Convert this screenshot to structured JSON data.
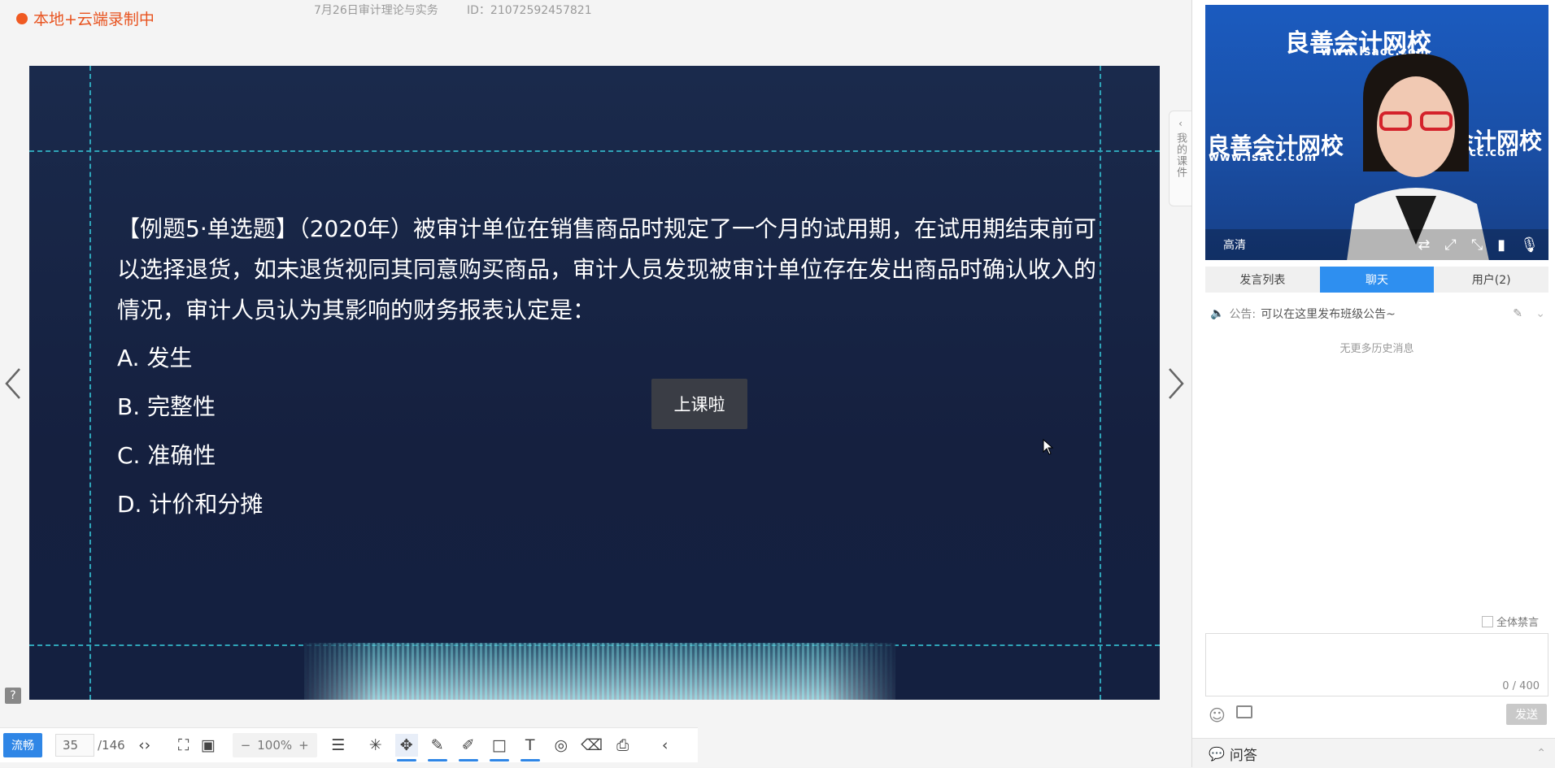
{
  "header": {
    "recording_status": "本地+云端录制中",
    "course_title": "7月26日审计理论与实务",
    "course_id": "ID：21072592457821"
  },
  "slide": {
    "question": "【例题5·单选题】（2020年）被审计单位在销售商品时规定了一个月的试用期，在试用期结束前可以选择退货，如未退货视同其同意购买商品，审计人员发现被审计单位存在发出商品时确认收入的情况，审计人员认为其影响的财务报表认定是：",
    "options": [
      "A. 发生",
      "B. 完整性",
      "C. 准确性",
      "D. 计价和分摊"
    ],
    "toast": "上课啦"
  },
  "side_tab": {
    "label": "我的课件"
  },
  "toolbar": {
    "smooth_label": "流畅",
    "current_page": "35",
    "total_pages": "/146",
    "zoom": "100%"
  },
  "video": {
    "brand": "良善会计网校",
    "url": "www.lsacc.com",
    "quality": "高清"
  },
  "tabs": [
    {
      "label": "发言列表"
    },
    {
      "label": "聊天"
    },
    {
      "label": "用户(2)"
    }
  ],
  "notice": {
    "label": "公告:",
    "text": "可以在这里发布班级公告~"
  },
  "chat": {
    "no_history": "无更多历史消息",
    "mute_all": "全体禁言",
    "char_count": "0 / 400",
    "send_label": "发送"
  },
  "qa": {
    "label": "问答"
  },
  "colors": {
    "accent": "#2e8ff0",
    "recording": "#f05a22",
    "slide_bg": "#15203f"
  }
}
